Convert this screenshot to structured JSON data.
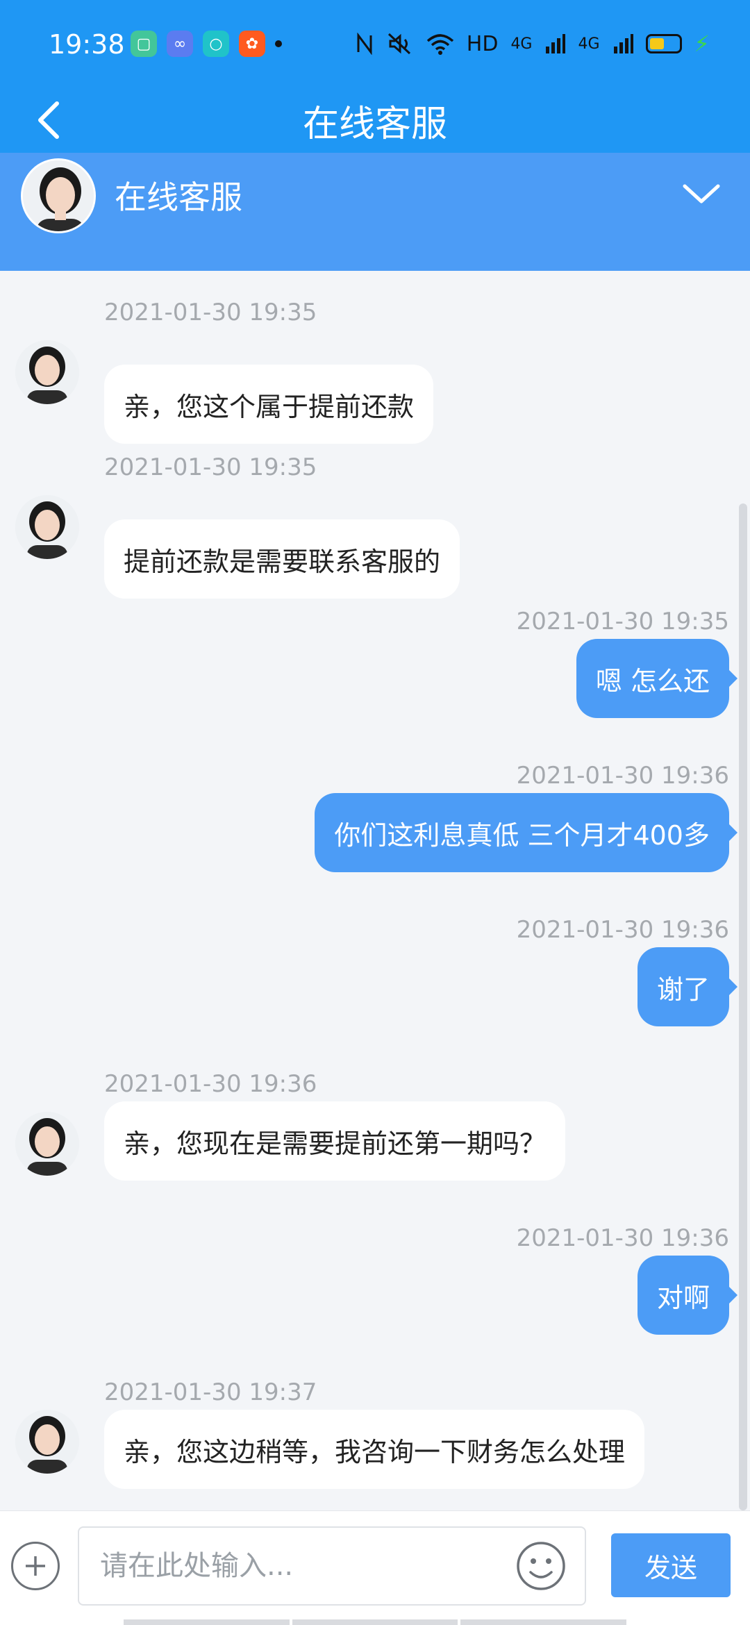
{
  "status_bar": {
    "time": "19:38",
    "apps": [
      {
        "icon": "app-green-icon",
        "color": "#43c69a"
      },
      {
        "icon": "infinity-app-icon",
        "color": "#5b7cf0"
      },
      {
        "icon": "teal-app-icon",
        "color": "#20c3c9"
      },
      {
        "icon": "kuaishou-app-icon",
        "color": "#ff5a1f"
      }
    ],
    "network_hd": "HD",
    "network_4g_1": "4G",
    "network_4g_2": "4G"
  },
  "title_bar": {
    "title": "在线客服"
  },
  "agent_header": {
    "name": "在线客服"
  },
  "messages": [
    {
      "side": "in",
      "timestamp": "2021-01-30 19:35",
      "text": "亲，您这个属于提前还款"
    },
    {
      "side": "in",
      "timestamp": "2021-01-30 19:35",
      "text": "提前还款是需要联系客服的"
    },
    {
      "side": "out",
      "timestamp": "2021-01-30 19:35",
      "text": "嗯 怎么还"
    },
    {
      "side": "out",
      "timestamp": "2021-01-30 19:36",
      "text": "你们这利息真低 三个月才400多"
    },
    {
      "side": "out",
      "timestamp": "2021-01-30 19:36",
      "text": "谢了"
    },
    {
      "side": "in",
      "timestamp": "2021-01-30 19:36",
      "text": "亲，您现在是需要提前还第一期吗？"
    },
    {
      "side": "out",
      "timestamp": "2021-01-30 19:36",
      "text": "对啊"
    },
    {
      "side": "in",
      "timestamp": "2021-01-30 19:37",
      "text": "亲，您这边稍等，我咨询一下财务怎么处理"
    }
  ],
  "input_bar": {
    "placeholder": "请在此处输入...",
    "send_label": "发送"
  },
  "colors": {
    "header_blue": "#1f97f4",
    "bubble_blue": "#4c9cf6",
    "chat_bg": "#f3f5f8"
  }
}
